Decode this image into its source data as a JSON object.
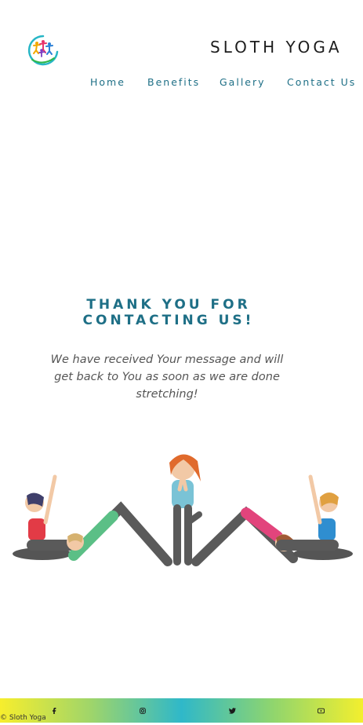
{
  "brand": {
    "logo_icon": "yoga-people-circle-logo",
    "title": "SLOTH YOGA"
  },
  "nav": {
    "items": [
      {
        "label": "Home"
      },
      {
        "label": "Benefits"
      },
      {
        "label": "Gallery"
      },
      {
        "label": "Contact Us"
      }
    ]
  },
  "main": {
    "heading_line1": "THANK YOU FOR",
    "heading_line2": "CONTACTING US!",
    "message": "We have received Your message and will get back to You as soon as we are done stretching!",
    "illustration_icon": "yoga-kids-poses-illustration"
  },
  "footer": {
    "icons": [
      "facebook-icon",
      "instagram-icon",
      "twitter-icon",
      "youtube-icon"
    ],
    "copyright": "© Sloth Yoga",
    "gradient_colors": [
      "#f7ee2d",
      "#2fb8c9"
    ]
  },
  "colors": {
    "accent": "#1e6f86",
    "text_dark": "#1d1d1d",
    "message_text": "#555555"
  }
}
